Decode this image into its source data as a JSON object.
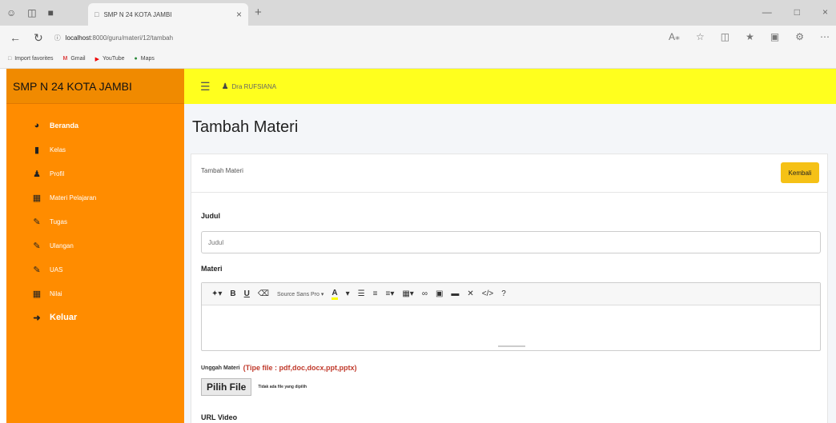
{
  "browser": {
    "tab_title": "SMP N 24 KOTA JAMBI",
    "url_host": "localhost",
    "url_path": ":8000/guru/materi/12/tambah",
    "bookmarks": [
      "Import favorites",
      "Gmail",
      "YouTube",
      "Maps"
    ]
  },
  "sidebar": {
    "brand": "SMP N 24 KOTA JAMBI",
    "items": [
      {
        "label": "Beranda",
        "icon": "dashboard-icon"
      },
      {
        "label": "Kelas",
        "icon": "file-icon"
      },
      {
        "label": "Profil",
        "icon": "user-icon"
      },
      {
        "label": "Materi Pelajaran",
        "icon": "book-icon"
      },
      {
        "label": "Tugas",
        "icon": "edit-icon"
      },
      {
        "label": "Ulangan",
        "icon": "edit-icon"
      },
      {
        "label": "UAS",
        "icon": "edit-icon"
      },
      {
        "label": "Nilai",
        "icon": "book-icon"
      },
      {
        "label": "Keluar",
        "icon": "logout-icon"
      }
    ]
  },
  "header": {
    "user_name": "Dra RUFSIANA"
  },
  "main": {
    "page_title": "Tambah Materi",
    "card_title": "Tambah Materi",
    "back_button": "Kembali",
    "judul_label": "Judul",
    "judul_placeholder": "Judul",
    "materi_label": "Materi",
    "editor_font": "Source Sans Pro",
    "upload_label": "Unggah Materi",
    "upload_hint": "(Tipe file : pdf,doc,docx,ppt,pptx)",
    "file_button": "Pilih File",
    "file_none": "Tidak ada file yang dipilih",
    "url_video_label": "URL Video"
  },
  "colors": {
    "sidebar": "#ff8c00",
    "topbar": "#ffff1e",
    "button_warning": "#f5c116",
    "hint_red": "#c0392b"
  }
}
